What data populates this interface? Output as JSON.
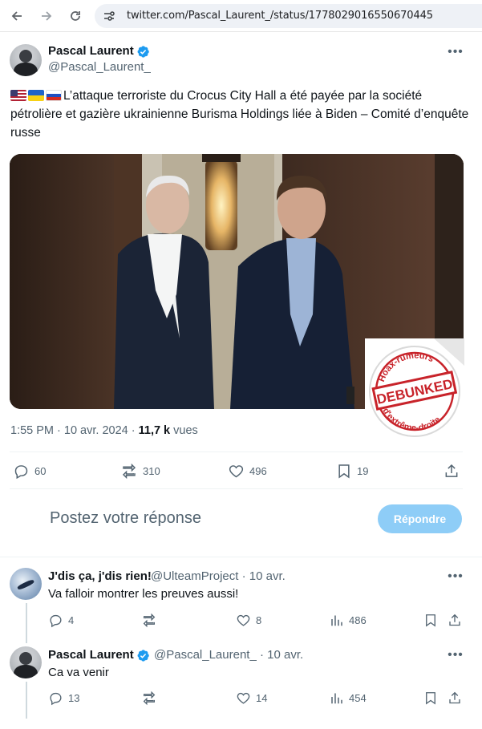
{
  "browser": {
    "url": "twitter.com/Pascal_Laurent_/status/1778029016550670445",
    "icons": [
      "back-arrow-icon",
      "forward-arrow-icon",
      "reload-icon",
      "site-settings-icon"
    ]
  },
  "tweet": {
    "author_name": "Pascal Laurent",
    "author_handle": "@Pascal_Laurent_",
    "text": "L’attaque terroriste du Crocus City Hall a été payée par la société pétrolière et gazière ukrainienne Burisma Holdings liée à Biden – Comité d’enquête russe",
    "flags": [
      "us-flag-icon",
      "ukraine-flag-icon",
      "russia-flag-icon"
    ],
    "time": "1:55 PM",
    "date": "10 avr. 2024",
    "views_count": "11,7 k",
    "views_label": "vues",
    "sticker": {
      "top_text": "Hoax-rumeurs",
      "main_text": "DEBUNKED",
      "bottom_text": "d'extrême-droite"
    },
    "stats": {
      "replies": "60",
      "retweets": "310",
      "likes": "496",
      "bookmarks": "19"
    }
  },
  "compose": {
    "placeholder": "Postez votre réponse",
    "button_label": "Répondre"
  },
  "replies": [
    {
      "name": "J'dis ça, j'dis rien!",
      "handle": "@UlteamProject",
      "date": "10 avr.",
      "text": "Va falloir montrer les preuves aussi!",
      "stats": {
        "replies": "4",
        "retweets": "",
        "likes": "8",
        "views": "486"
      }
    },
    {
      "name": "Pascal Laurent",
      "handle": "@Pascal_Laurent_",
      "date": "10 avr.",
      "text": "Ca va venir",
      "stats": {
        "replies": "13",
        "retweets": "",
        "likes": "14",
        "views": "454"
      }
    }
  ],
  "colors": {
    "accent": "#1d9bf0",
    "reply_button": "#8ecdf7",
    "secondary_text": "#536471",
    "sticker_red": "#c8232a"
  }
}
